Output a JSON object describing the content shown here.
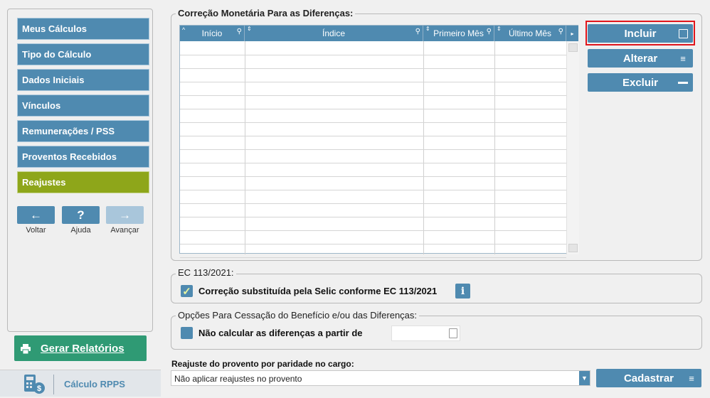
{
  "sidebar": {
    "items": [
      {
        "label": "Meus Cálculos",
        "active": false
      },
      {
        "label": "Tipo do Cálculo",
        "active": false
      },
      {
        "label": "Dados Iniciais",
        "active": false
      },
      {
        "label": "Vínculos",
        "active": false
      },
      {
        "label": "Remunerações / PSS",
        "active": false
      },
      {
        "label": "Proventos Recebidos",
        "active": false
      },
      {
        "label": "Reajustes",
        "active": true
      }
    ],
    "back_label": "Voltar",
    "help_label": "Ajuda",
    "next_label": "Avançar",
    "report_button": "Gerar Relatórios",
    "footer_label": "Cálculo RPPS"
  },
  "correction": {
    "legend": "Correção Monetária Para as Diferenças:",
    "columns": [
      "Início",
      "Índice",
      "Primeiro Mês",
      "Último Mês"
    ],
    "rows": []
  },
  "actions": {
    "include": "Incluir",
    "edit": "Alterar",
    "delete": "Excluir"
  },
  "ec": {
    "legend": "EC 113/2021:",
    "checkbox_label": "Correção substituída pela Selic conforme EC 113/2021",
    "checked": true,
    "info": "i"
  },
  "cessation": {
    "legend": "Opções Para Cessação do Benefício e/ou das Diferenças:",
    "checkbox_label": "Não calcular as diferenças a partir de",
    "checked": false,
    "date_value": ""
  },
  "parity": {
    "label": "Reajuste do provento por paridade no cargo:",
    "selected": "Não aplicar reajustes no provento",
    "register_button": "Cadastrar"
  },
  "colors": {
    "primary": "#4f8ab0",
    "active": "#8ea61a",
    "report": "#2f9a74",
    "highlight": "#e0161c"
  }
}
